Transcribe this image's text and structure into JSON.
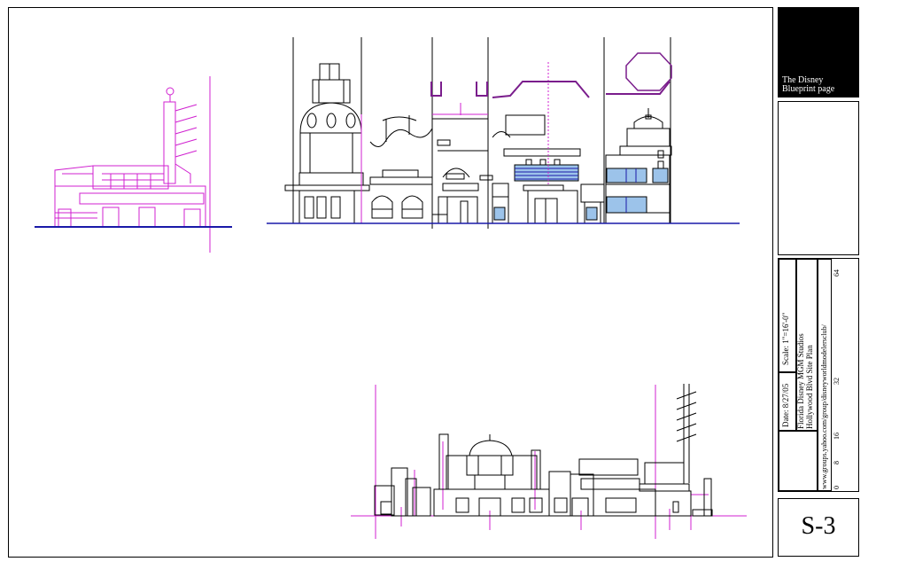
{
  "title_block": {
    "logo_line1": "The Disney",
    "logo_line2": "Blueprint page",
    "date_label": "Date:  8/27/05",
    "scale_label": "Scale:  1\"=16'-0\"",
    "project_line1": "Florida Disney MGM Studios",
    "project_line2": "Hollywood Blvd Site Plan",
    "url": "www.groups.yahoo.com/group/disneyworldmodelersclub/",
    "scale_ticks": [
      "0",
      "8",
      "16",
      "32",
      "64"
    ],
    "sheet_number": "S-3"
  },
  "colors": {
    "line": "#000000",
    "magenta": "#d020d0",
    "purple": "#7a1d8c",
    "ground_blue": "#1a1aa8",
    "window_blue": "#9cc3ea"
  }
}
